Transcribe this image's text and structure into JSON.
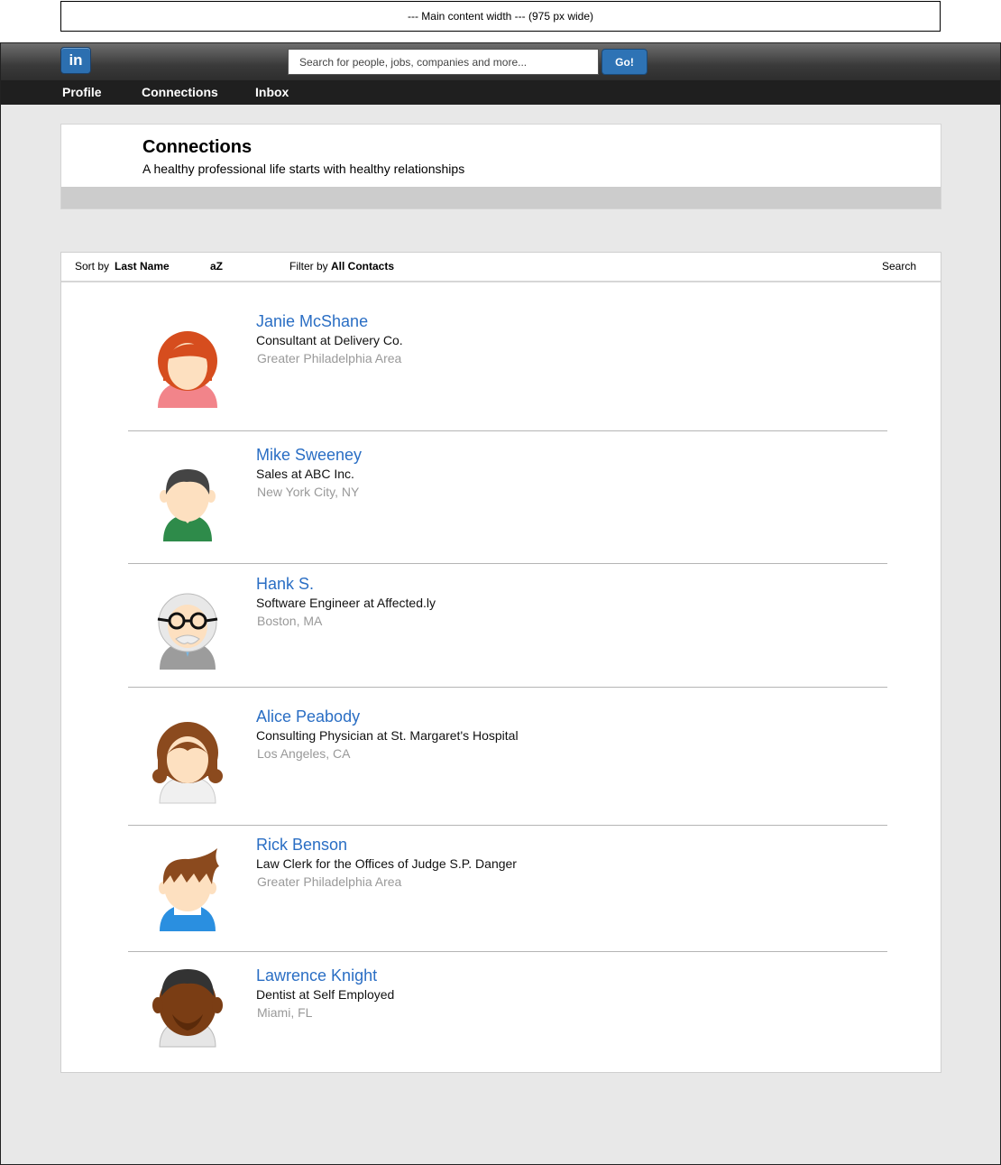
{
  "width_note": "--- Main content width --- (975 px wide)",
  "topbar": {
    "logo": "in",
    "search_placeholder": "Search for people, jobs, companies and more...",
    "go_label": "Go!"
  },
  "nav": [
    {
      "label": "Profile"
    },
    {
      "label": "Connections"
    },
    {
      "label": "Inbox"
    }
  ],
  "header": {
    "title": "Connections",
    "subtitle": "A healthy professional life starts with healthy relationships"
  },
  "toolbar": {
    "sort_label": "Sort by",
    "sort_value": "Last Name",
    "order": "aZ",
    "filter_label": "Filter by",
    "filter_value": "All Contacts",
    "search_label": "Search"
  },
  "contacts": [
    {
      "name": "Janie McShane",
      "title": "Consultant at Delivery Co.",
      "location": "Greater Philadelphia Area",
      "avatar": "red-haired-woman-avatar-icon"
    },
    {
      "name": "Mike Sweeney",
      "title": "Sales at ABC Inc.",
      "location": "New York City, NY",
      "avatar": "dark-haired-man-avatar-icon"
    },
    {
      "name": "Hank S.",
      "title": "Software Engineer at Affected.ly",
      "location": "Boston, MA",
      "avatar": "old-man-glasses-avatar-icon"
    },
    {
      "name": "Alice Peabody",
      "title": "Consulting Physician at St. Margaret's Hospital",
      "location": "Los Angeles, CA",
      "avatar": "brown-haired-woman-avatar-icon"
    },
    {
      "name": "Rick Benson",
      "title": "Law Clerk for the Offices of Judge S.P. Danger",
      "location": "Greater Philadelphia Area",
      "avatar": "brown-haired-boy-avatar-icon"
    },
    {
      "name": "Lawrence Knight",
      "title": "Dentist at Self Employed",
      "location": "Miami, FL",
      "avatar": "bearded-man-avatar-icon"
    }
  ]
}
